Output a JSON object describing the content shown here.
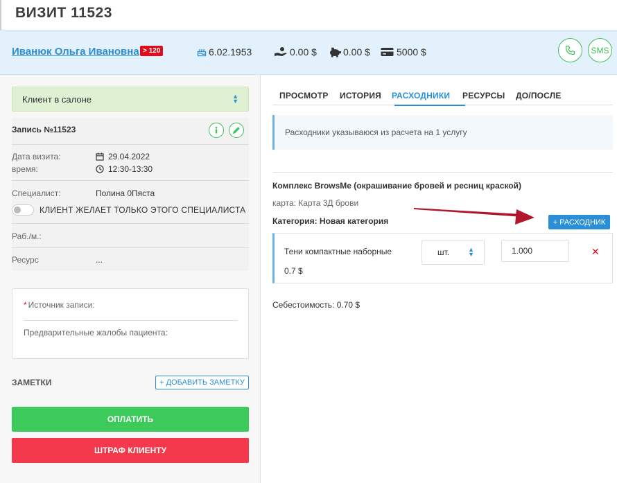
{
  "page": {
    "title": "ВИЗИТ 11523"
  },
  "client": {
    "name": "Иванюк Ольга Ивановна",
    "badge": "> 120",
    "birthdate": "6.02.1953",
    "balance1": "0.00 $",
    "balance2": "0.00 $",
    "balance3": "5000 $",
    "phone_icon": "phone-icon",
    "sms_label": "SMS"
  },
  "left": {
    "status": "Клиент в салоне",
    "record_title": "Запись №11523",
    "date_label": "Дата визита:",
    "date_value": "29.04.2022",
    "time_label": "время:",
    "time_value": "12:30-13:30",
    "specialist_label": "Специалист:",
    "specialist_value": "Полина 0Пяста",
    "only_specialist": "КЛИЕНТ ЖЕЛАЕТ ТОЛЬКО ЭТОГО СПЕЦИАЛИСТА",
    "workplace_label": "Раб./м.:",
    "resource_label": "Ресурс",
    "resource_value": "...",
    "source_label": "Источник записи:",
    "complaints_label": "Предварительные жалобы пациента:",
    "notes_title": "ЗАМЕТКИ",
    "add_note": "+ ДОБАВИТЬ ЗАМЕТКУ",
    "pay": "ОПЛАТИТЬ",
    "fine": "ШТРАФ КЛИЕНТУ"
  },
  "right": {
    "tabs": [
      "ПРОСМОТР",
      "ИСТОРИЯ",
      "РАСХОДНИКИ",
      "РЕСУРСЫ",
      "ДО/ПОСЛЕ"
    ],
    "active_tab": "РАСХОДНИКИ",
    "notice": "Расходники указываюся из расчета на 1 услугу",
    "complex_title": "Комплекс BrowsMe (окрашивание бровей и ресниц краской)",
    "card": "карта: Карта 3Д брови",
    "category": "Категория: Новая категория",
    "add_consumable": "+ РАСХОДНИК",
    "consumable": {
      "name": "Тени компактные наборные",
      "price": "0.7 $",
      "unit": "шт.",
      "quantity": "1.000",
      "delete": "✕"
    },
    "cost": "Себестоимость: 0.70 $"
  },
  "colors": {
    "accent": "#2a8fd6",
    "green": "#3cca5a",
    "red": "#f5394c",
    "arrow": "#b0172c"
  }
}
